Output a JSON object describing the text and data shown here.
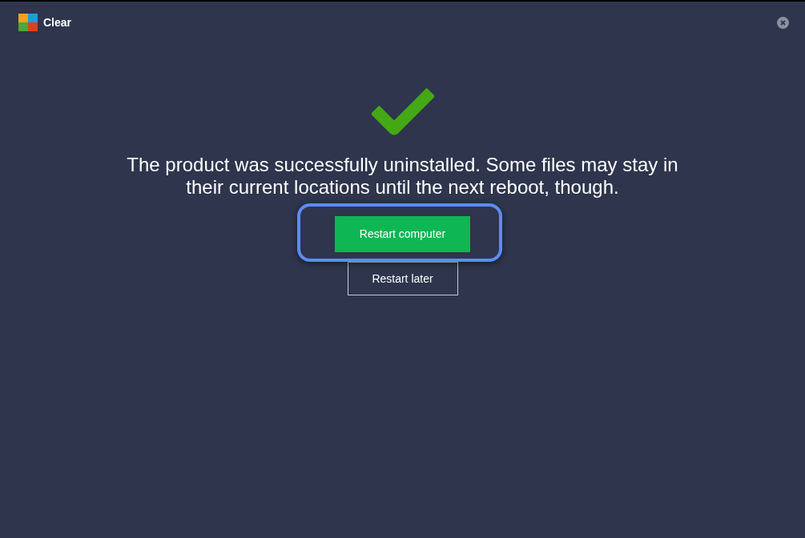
{
  "window": {
    "title": "Clear"
  },
  "message": "The product was successfully uninstalled. Some files may stay in their current locations until the next reboot, though.",
  "buttons": [
    {
      "label": "Restart computer",
      "kind": "primary",
      "highlighted": true
    },
    {
      "label": "Restart later",
      "kind": "secondary",
      "highlighted": false
    }
  ]
}
